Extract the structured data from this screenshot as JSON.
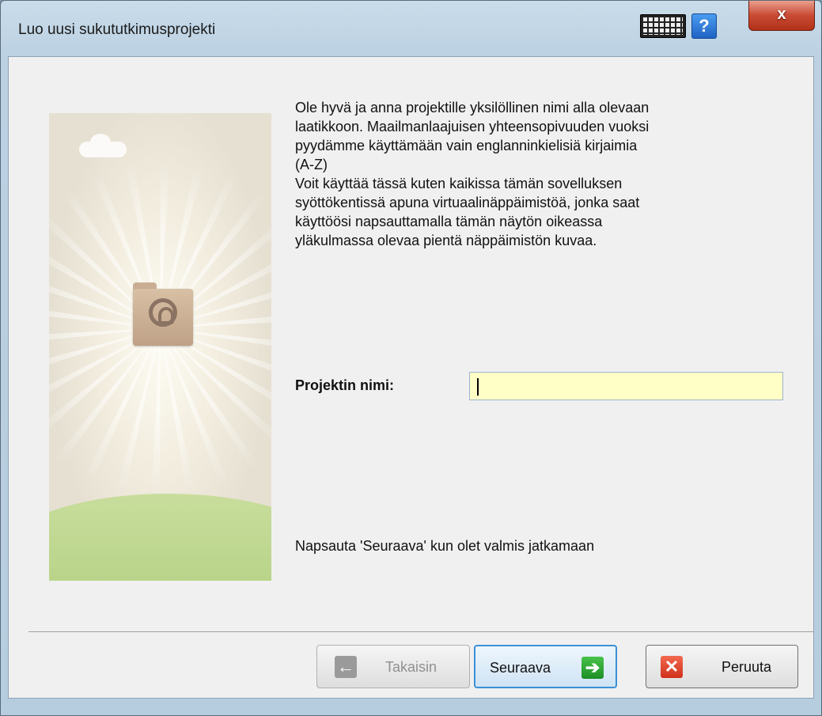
{
  "window": {
    "title": "Luo uusi sukututkimusprojekti",
    "close_label": "x",
    "help_label": "?"
  },
  "content": {
    "instructions": "Ole hyvä ja anna projektille yksilöllinen nimi alla olevaan\nlaatikkoon. Maailmanlaajuisen yhteensopivuuden vuoksi\npyydämme käyttämään vain englanninkielisiä kirjaimia\n(A-Z)\nVoit käyttää tässä kuten kaikissa tämän sovelluksen\nsyöttökentissä apuna virtuaalinäppäimistöä, jonka saat\nkäyttöösi napsauttamalla tämän näytön oikeassa\nyläkulmassa olevaa pientä näppäimistön kuvaa.",
    "project_name_label": "Projektin nimi:",
    "project_name_value": "",
    "hint": "Napsauta 'Seuraava' kun olet valmis jatkamaan"
  },
  "buttons": {
    "back": "Takaisin",
    "next": "Seuraava",
    "cancel": "Peruuta"
  },
  "icons": {
    "keyboard": "keyboard-icon",
    "help": "help-icon",
    "close": "close-icon",
    "back": "arrow-left-icon",
    "next": "arrow-right-icon",
    "cancel": "x-icon",
    "folder": "family-tree-folder-icon"
  },
  "colors": {
    "input_background": "#ffffc6",
    "next_accent": "#3c8fd6",
    "next_icon": "#1d8f25",
    "cancel_icon": "#d0301c"
  }
}
